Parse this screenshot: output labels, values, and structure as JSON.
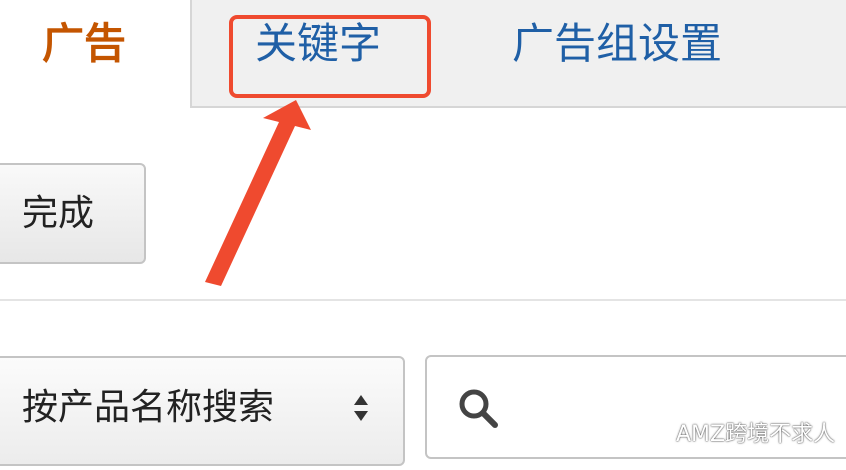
{
  "tabs": {
    "active_label": "广告",
    "keywords_label": "关键字",
    "settings_label": "广告组设置"
  },
  "toolbar": {
    "done_label": "完成"
  },
  "search": {
    "select_label": "按产品名称搜索",
    "value": ""
  },
  "watermark": {
    "text": "AMZ跨境不求人"
  },
  "colors": {
    "active_tab": "#c45500",
    "tab_link": "#1f5fa6",
    "annotation": "#ef4a2f"
  }
}
